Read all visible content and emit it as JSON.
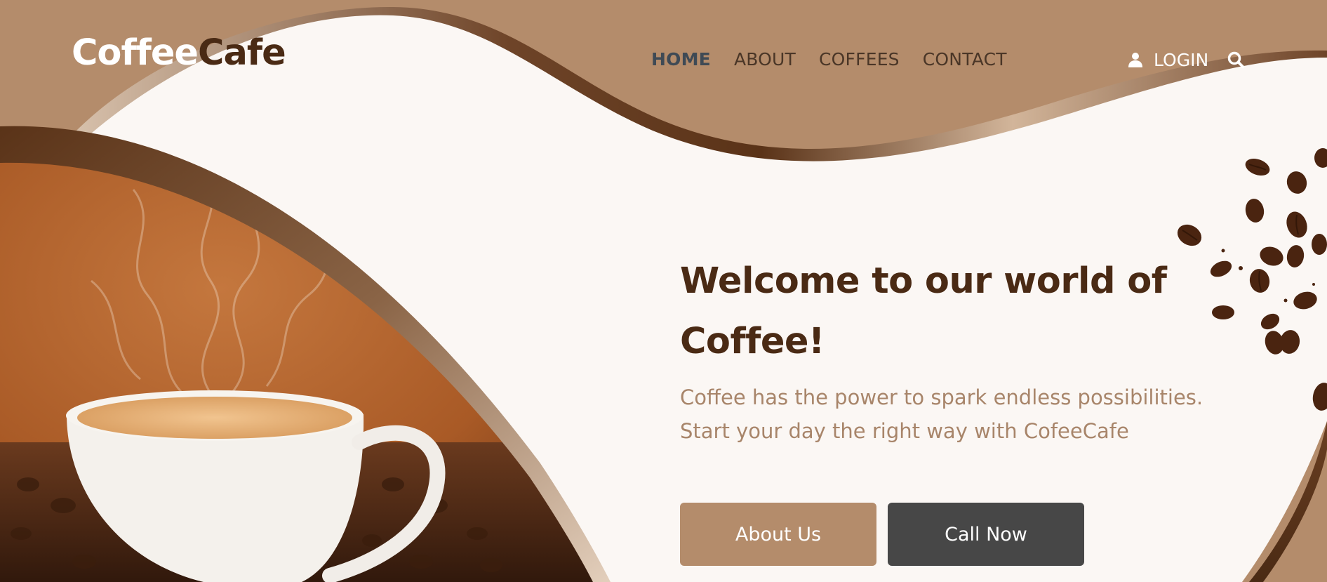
{
  "header": {
    "logo_part1": "Coffee",
    "logo_part2": "Cafe",
    "nav": [
      {
        "label": "HOME",
        "active": true
      },
      {
        "label": "ABOUT",
        "active": false
      },
      {
        "label": "COFFEES",
        "active": false
      },
      {
        "label": "CONTACT",
        "active": false
      }
    ],
    "login_label": "LOGIN",
    "icons": [
      "user-icon",
      "search-icon"
    ]
  },
  "hero": {
    "title": "Welcome to our world of Coffee!",
    "subtitle_line1": "Coffee has the power to spark endless possibilities.",
    "subtitle_line2": "Start your day the right way with CofeeCafe",
    "buttons": {
      "about": "About Us",
      "call": "Call Now"
    }
  },
  "colors": {
    "brand_brown": "#b48c6b",
    "dark_brown": "#4a2a14",
    "cream": "#fbf7f4",
    "dark_button": "#474747",
    "subtitle": "#a8856a"
  }
}
